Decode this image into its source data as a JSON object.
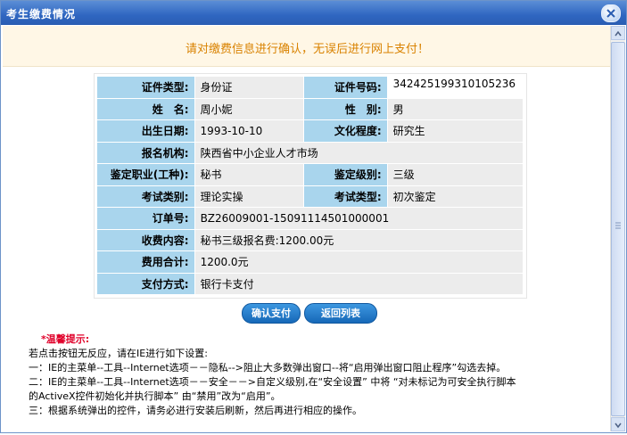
{
  "window": {
    "title": "考生缴费情况"
  },
  "banner": {
    "text": "请对缴费信息进行确认，无误后进行网上支付！"
  },
  "fields": {
    "id_type_label": "证件类型:",
    "id_type": "身份证",
    "id_no_label": "证件号码:",
    "id_no": "342425199310105236",
    "name_label": "姓　名:",
    "name": "周小妮",
    "gender_label": "性　别:",
    "gender": "男",
    "birth_label": "出生日期:",
    "birth": "1993-10-10",
    "edu_label": "文化程度:",
    "edu": "研究生",
    "org_label": "报名机构:",
    "org": "陕西省中小企业人才市场",
    "job_label": "鉴定职业(工种):",
    "job": "秘书",
    "level_label": "鉴定级别:",
    "level": "三级",
    "exam_cat_label": "考试类别:",
    "exam_cat": "理论实操",
    "exam_type_label": "考试类型:",
    "exam_type": "初次鉴定",
    "order_label": "订单号:",
    "order": "BZ26009001-15091114501000001",
    "fee_content_label": "收费内容:",
    "fee_content": "秘书三级报名费:1200.00元",
    "fee_total_label": "费用合计:",
    "fee_total": "1200.0元",
    "pay_method_label": "支付方式:",
    "pay_method": "银行卡支付"
  },
  "buttons": {
    "confirm": "确认支付",
    "back": "返回列表"
  },
  "tips": {
    "head": "*温馨提示:",
    "line0": "若点击按钮无反应，请在IE进行如下设置:",
    "line1": "一：IE的主菜单--工具--Internet选项－－隐私-->阻止大多数弹出窗口--将“启用弹出窗口阻止程序”勾选去掉。",
    "line2a": "二：IE的主菜单--工具--Internet选项－－安全－－>自定义级别,在“安全设置” 中将 “对未标记为可安全执行脚本",
    "line2b": "的ActiveX控件初始化并执行脚本” 由“禁用”改为“启用”。",
    "line3": "三：根据系统弹出的控件，请务必进行安装后刷新，然后再进行相应的操作。"
  },
  "colors": {
    "label_bg": "#a9d5ed",
    "value_bg": "#ececec",
    "banner_text": "#d98200",
    "tip_head": "#e0002a"
  }
}
